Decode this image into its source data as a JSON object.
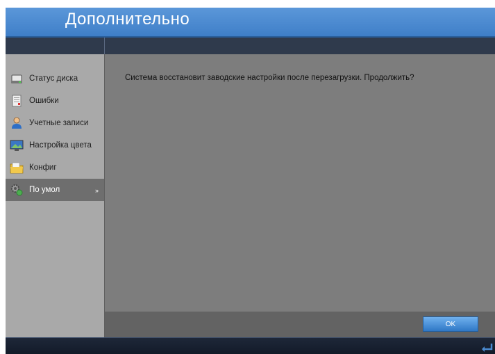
{
  "window": {
    "title": "Дополнительно"
  },
  "sidebar": {
    "items": [
      {
        "label": "Статус диска",
        "icon": "disk-icon"
      },
      {
        "label": "Ошибки",
        "icon": "error-log-icon"
      },
      {
        "label": "Учетные записи",
        "icon": "user-icon"
      },
      {
        "label": "Настройка цвета",
        "icon": "monitor-icon"
      },
      {
        "label": "Конфиг",
        "icon": "folder-icon"
      },
      {
        "label": "По умол",
        "icon": "default-gear-icon",
        "active": true,
        "marker": "»"
      }
    ]
  },
  "main": {
    "message": "Система восстановит заводские настройки после перезагрузки. Продолжить?"
  },
  "actions": {
    "ok_label": "OK"
  },
  "colors": {
    "accent": "#4a8ad0",
    "sidebar_bg": "#a9a9a9",
    "content_bg": "#7d7d7d",
    "status_bar_bg": "#1a2232"
  }
}
